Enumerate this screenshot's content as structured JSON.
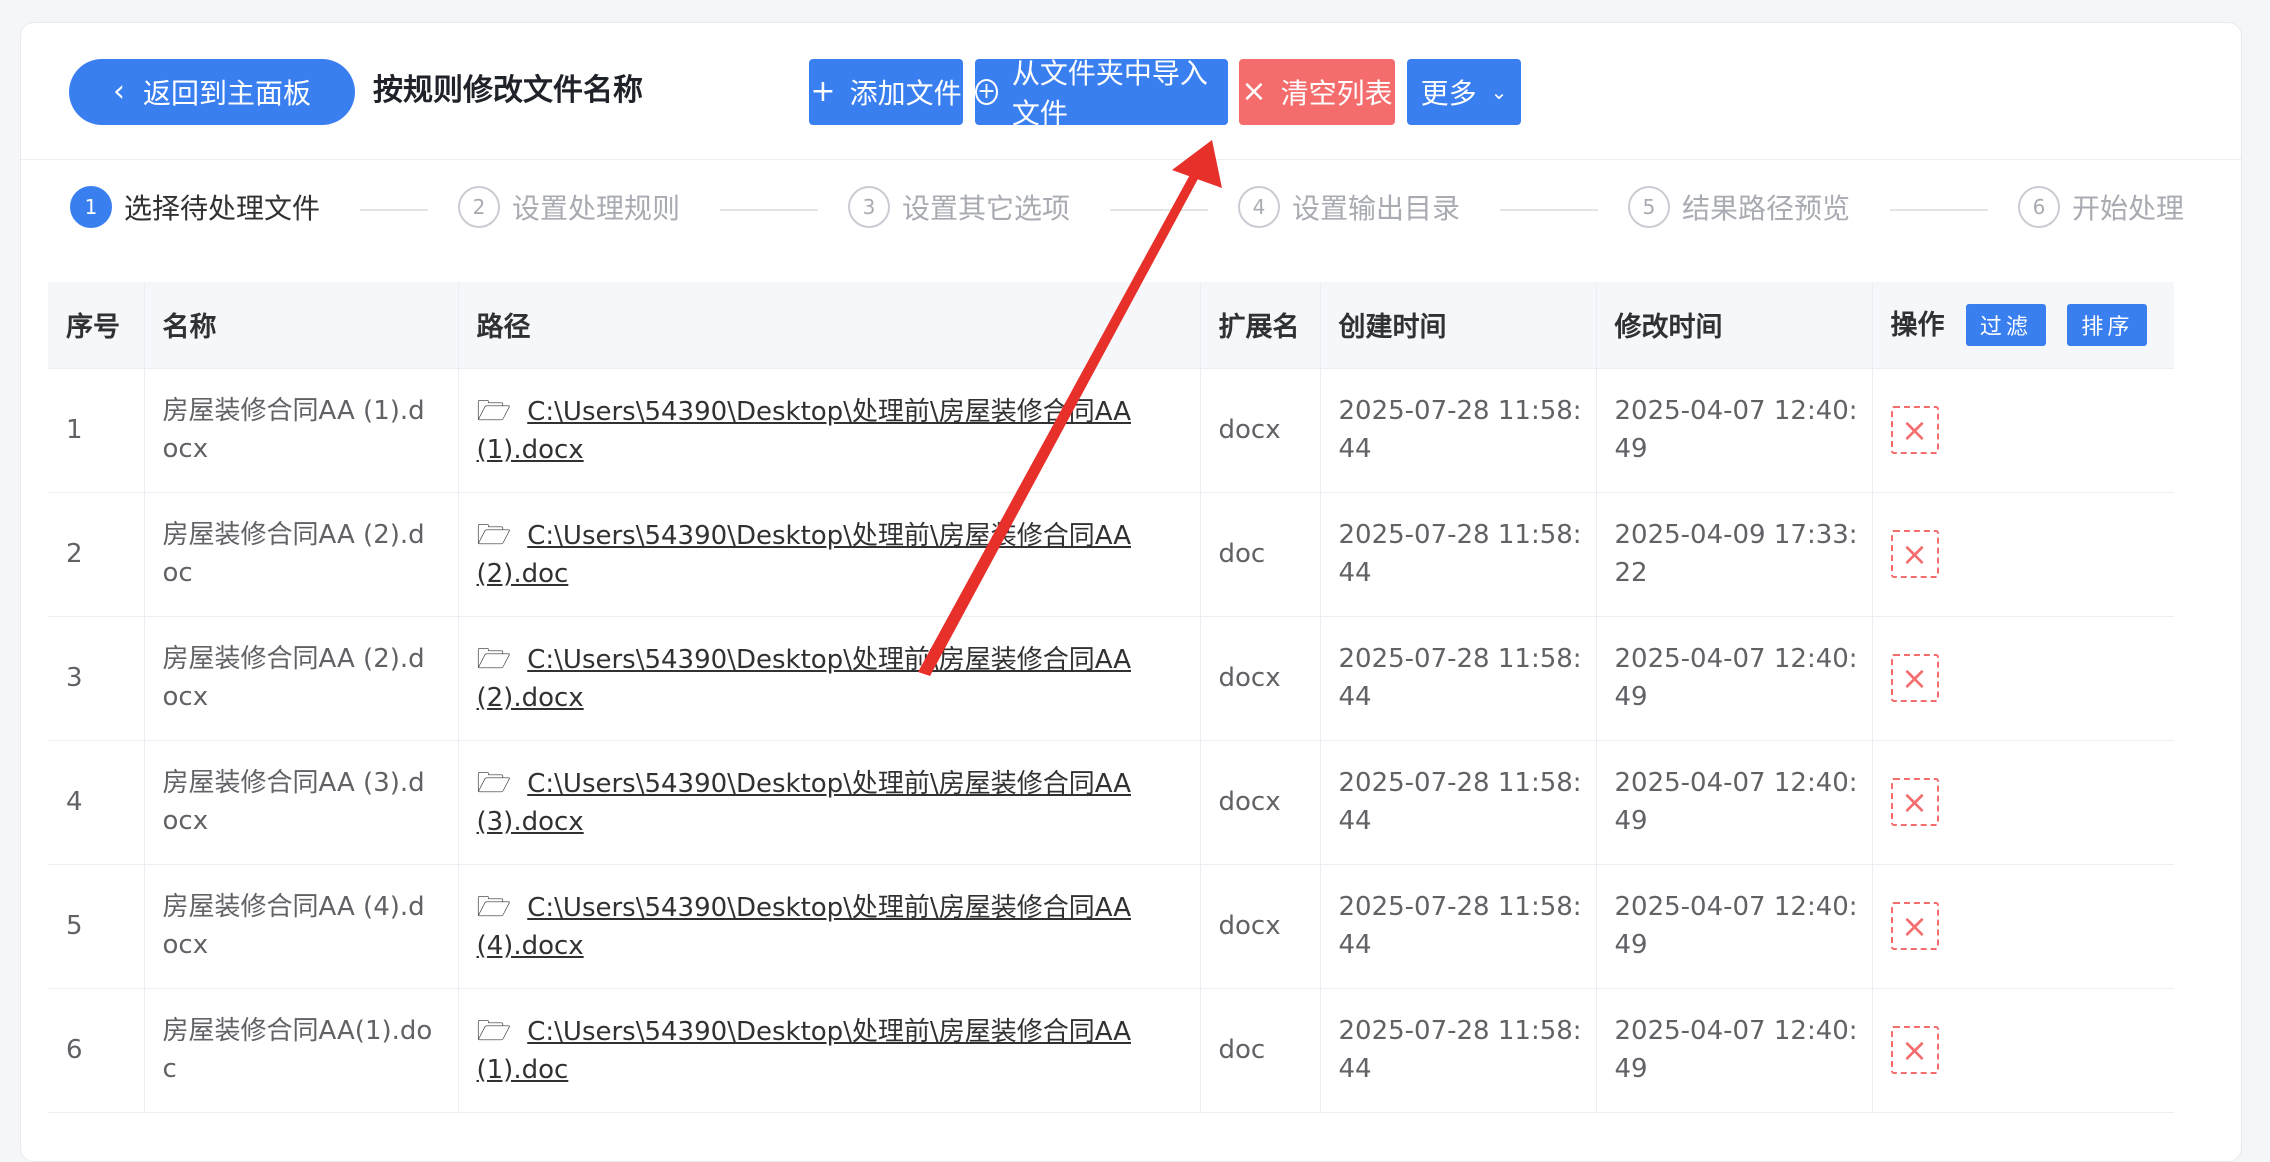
{
  "header": {
    "back_label": "返回到主面板",
    "title": "按规则修改文件名称",
    "buttons": {
      "add_files": "添加文件",
      "import_folder": "从文件夹中导入文件",
      "clear_list": "清空列表",
      "more": "更多"
    }
  },
  "steps": [
    {
      "num": "1",
      "label": "选择待处理文件"
    },
    {
      "num": "2",
      "label": "设置处理规则"
    },
    {
      "num": "3",
      "label": "设置其它选项"
    },
    {
      "num": "4",
      "label": "设置输出目录"
    },
    {
      "num": "5",
      "label": "结果路径预览"
    },
    {
      "num": "6",
      "label": "开始处理"
    }
  ],
  "table": {
    "headers": {
      "index": "序号",
      "name": "名称",
      "path": "路径",
      "ext": "扩展名",
      "created": "创建时间",
      "modified": "修改时间",
      "actions": "操作",
      "filter": "过滤",
      "sort": "排序"
    },
    "rows": [
      {
        "index": "1",
        "name1": "房屋装修合同AA (1).d",
        "name2": "ocx",
        "path1": "C:\\Users\\54390\\Desktop\\处理前\\房屋装修合同AA",
        "path2": "(1).docx",
        "ext": "docx",
        "created1": "2025-07-28 11:58:",
        "created2": "44",
        "modified1": "2025-04-07 12:40:",
        "modified2": "49"
      },
      {
        "index": "2",
        "name1": "房屋装修合同AA (2).d",
        "name2": "oc",
        "path1": "C:\\Users\\54390\\Desktop\\处理前\\房屋装修合同AA",
        "path2": "(2).doc",
        "ext": "doc",
        "created1": "2025-07-28 11:58:",
        "created2": "44",
        "modified1": "2025-04-09 17:33:",
        "modified2": "22"
      },
      {
        "index": "3",
        "name1": "房屋装修合同AA (2).d",
        "name2": "ocx",
        "path1": "C:\\Users\\54390\\Desktop\\处理前\\房屋装修合同AA",
        "path2": "(2).docx",
        "ext": "docx",
        "created1": "2025-07-28 11:58:",
        "created2": "44",
        "modified1": "2025-04-07 12:40:",
        "modified2": "49"
      },
      {
        "index": "4",
        "name1": "房屋装修合同AA (3).d",
        "name2": "ocx",
        "path1": "C:\\Users\\54390\\Desktop\\处理前\\房屋装修合同AA",
        "path2": "(3).docx",
        "ext": "docx",
        "created1": "2025-07-28 11:58:",
        "created2": "44",
        "modified1": "2025-04-07 12:40:",
        "modified2": "49"
      },
      {
        "index": "5",
        "name1": "房屋装修合同AA (4).d",
        "name2": "ocx",
        "path1": "C:\\Users\\54390\\Desktop\\处理前\\房屋装修合同AA",
        "path2": "(4).docx",
        "ext": "docx",
        "created1": "2025-07-28 11:58:",
        "created2": "44",
        "modified1": "2025-04-07 12:40:",
        "modified2": "49"
      },
      {
        "index": "6",
        "name1": "房屋装修合同AA(1).do",
        "name2": "c",
        "path1": "C:\\Users\\54390\\Desktop\\处理前\\房屋装修合同AA",
        "path2": "(1).doc",
        "ext": "doc",
        "created1": "2025-07-28 11:58:",
        "created2": "44",
        "modified1": "2025-04-07 12:40:",
        "modified2": "49"
      }
    ]
  },
  "colors": {
    "primary": "#3a7ff0",
    "danger": "#f56c6c",
    "annotation_arrow": "#e8302a"
  }
}
